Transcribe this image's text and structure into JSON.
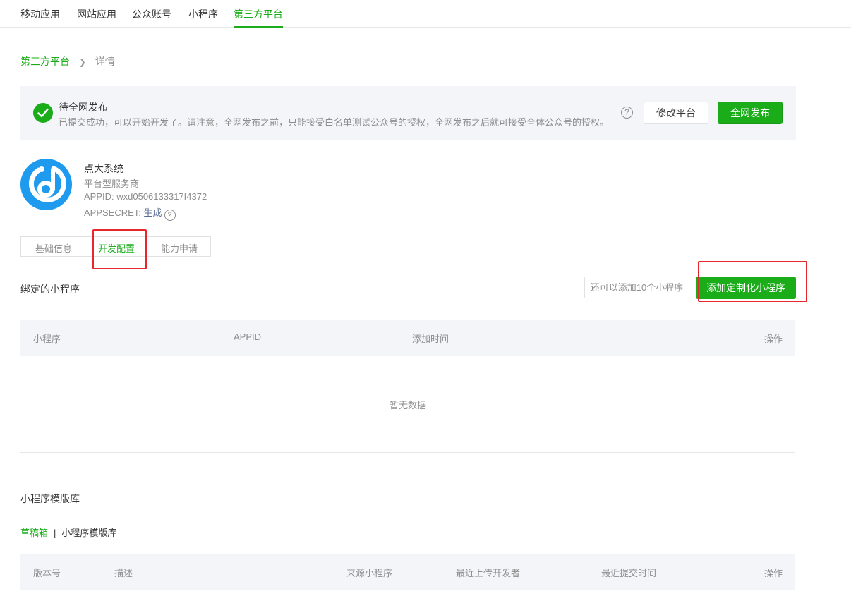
{
  "topnav": {
    "tabs": [
      "移动应用",
      "网站应用",
      "公众账号",
      "小程序",
      "第三方平台"
    ],
    "active": "第三方平台"
  },
  "breadcrumb": {
    "parent": "第三方平台",
    "sep": ">",
    "current": "详情"
  },
  "notice": {
    "title": "待全网发布",
    "desc": "已提交成功，可以开始开发了。请注意，全网发布之前，只能接受白名单测试公众号的授权，全网发布之后就可接受全体公众号的授权。",
    "help": "?",
    "modify_label": "修改平台",
    "publish_label": "全网发布"
  },
  "profile": {
    "name": "点大系统",
    "type": "平台型服务商",
    "appid": "APPID: wxd0506133317f4372",
    "secret_label": "APPSECRET: ",
    "secret_action": "生成",
    "help": "?"
  },
  "subtabs": [
    "基础信息",
    "开发配置",
    "能力申请"
  ],
  "subtabs_active": "开发配置",
  "bound": {
    "title": "绑定的小程序",
    "quota": "还可以添加10个小程序",
    "add_label": "添加定制化小程序",
    "columns": [
      "小程序",
      "APPID",
      "添加时间",
      "操作"
    ],
    "empty": "暂无数据"
  },
  "library": {
    "title": "小程序模版库",
    "tabs": [
      "草稿箱",
      "小程序模版库"
    ],
    "tab_sep": "|",
    "columns": [
      "版本号",
      "描述",
      "来源小程序",
      "最近上传开发者",
      "最近提交时间",
      "操作"
    ]
  },
  "colors": {
    "brand": "#1aad19",
    "highlight": "#e8272d",
    "link": "#576b95"
  }
}
